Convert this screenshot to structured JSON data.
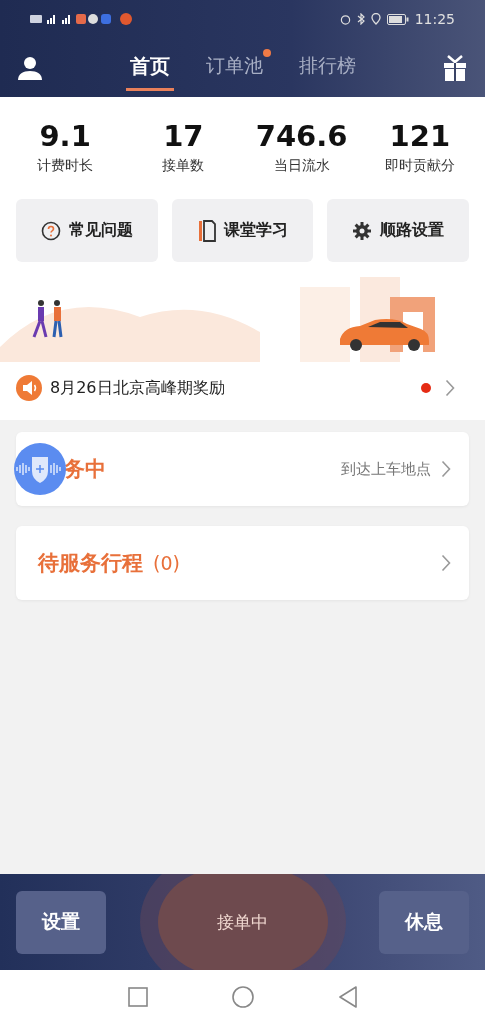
{
  "status_bar": {
    "time": "11:25"
  },
  "tabs": [
    {
      "label": "首页",
      "selected": true,
      "badge": false
    },
    {
      "label": "订单池",
      "selected": false,
      "badge": true
    },
    {
      "label": "排行榜",
      "selected": false,
      "badge": false
    }
  ],
  "stats": [
    {
      "value": "9.1",
      "label": "计费时长"
    },
    {
      "value": "17",
      "label": "接单数"
    },
    {
      "value": "746.6",
      "label": "当日流水"
    },
    {
      "value": "121",
      "label": "即时贡献分"
    }
  ],
  "shortcuts": [
    {
      "label": "常见问题",
      "kind": "question"
    },
    {
      "label": "课堂学习",
      "kind": "book"
    },
    {
      "label": "顺路设置",
      "kind": "gear"
    }
  ],
  "notice": {
    "text": "8月26日北京高峰期奖励",
    "unread": true
  },
  "cards": [
    {
      "title": "务中",
      "status": "到达上车地点"
    },
    {
      "title": "待服务行程",
      "count": "(0)"
    }
  ],
  "bottom_bar": {
    "left": "设置",
    "center": "接单中",
    "right": "休息"
  }
}
